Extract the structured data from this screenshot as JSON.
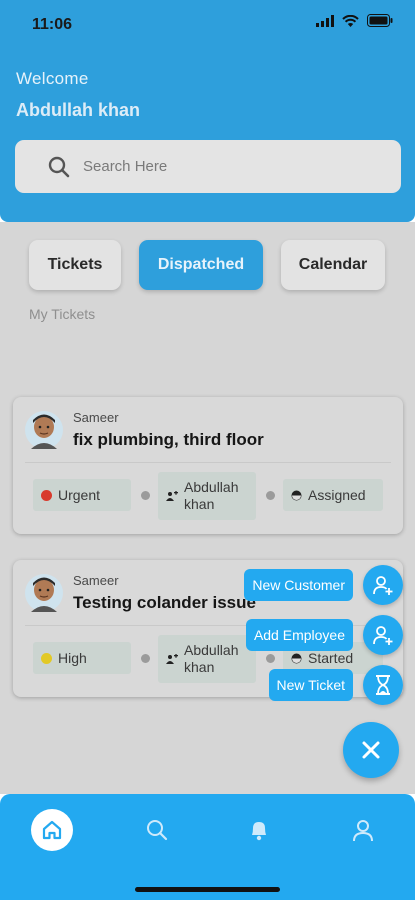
{
  "status_bar": {
    "time": "11:06"
  },
  "header": {
    "welcome": "Welcome",
    "username": "Abdullah khan",
    "search_placeholder": "Search Here"
  },
  "tabs": [
    {
      "label": "Tickets",
      "active": false
    },
    {
      "label": "Dispatched",
      "active": true
    },
    {
      "label": "Calendar",
      "active": false
    }
  ],
  "section_title": "My Tickets",
  "tickets": [
    {
      "creator": "Sameer",
      "title": "fix plumbing, third floor",
      "priority": "Urgent",
      "priority_color": "#d83a2c",
      "assignee_line1": "Abdullah",
      "assignee_line2": "khan",
      "status": "Assigned"
    },
    {
      "creator": "Sameer",
      "title": "Testing colander issue",
      "priority": "High",
      "priority_color": "#e2c925",
      "assignee_line1": "Abdullah",
      "assignee_line2": "khan",
      "status": "Started"
    }
  ],
  "fab_menu": [
    {
      "label": "New Customer",
      "icon": "person-add-icon"
    },
    {
      "label": "Add Employee",
      "icon": "person-add-icon"
    },
    {
      "label": "New Ticket",
      "icon": "hourglass-icon"
    }
  ],
  "fab_main_icon": "close-icon",
  "bottom_nav": [
    "home-icon",
    "search-icon",
    "bell-icon",
    "user-icon"
  ],
  "colors": {
    "header_blue": "#2e9fdc",
    "accent": "#23a9f0",
    "overlay_gray": "#d6d6d6"
  }
}
